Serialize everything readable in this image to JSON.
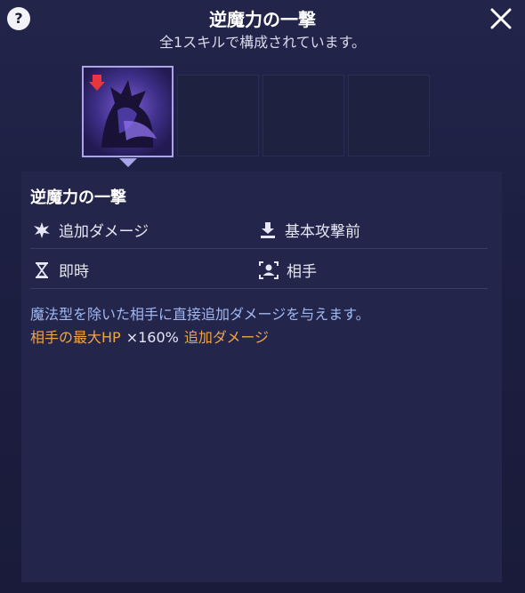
{
  "header": {
    "title": "逆魔力の一撃",
    "subtitle": "全1スキルで構成されています。",
    "help_label": "?"
  },
  "slots": [
    {
      "state": "selected"
    },
    {
      "state": "empty"
    },
    {
      "state": "empty"
    },
    {
      "state": "empty"
    }
  ],
  "skill": {
    "name": "逆魔力の一撃",
    "attributes": {
      "type": "追加ダメージ",
      "timing": "基本攻撃前",
      "cast": "即時",
      "target": "相手"
    },
    "description": "魔法型を除いた相手に直接追加ダメージを与えます。",
    "effect": {
      "stat": "相手の最大HP",
      "multiplier": "×160%",
      "kind": "追加ダメージ"
    }
  },
  "colors": {
    "background": "#1b1c3a",
    "panel": "#23254b",
    "description": "#9fb8f0",
    "effect": "#f0a445"
  }
}
